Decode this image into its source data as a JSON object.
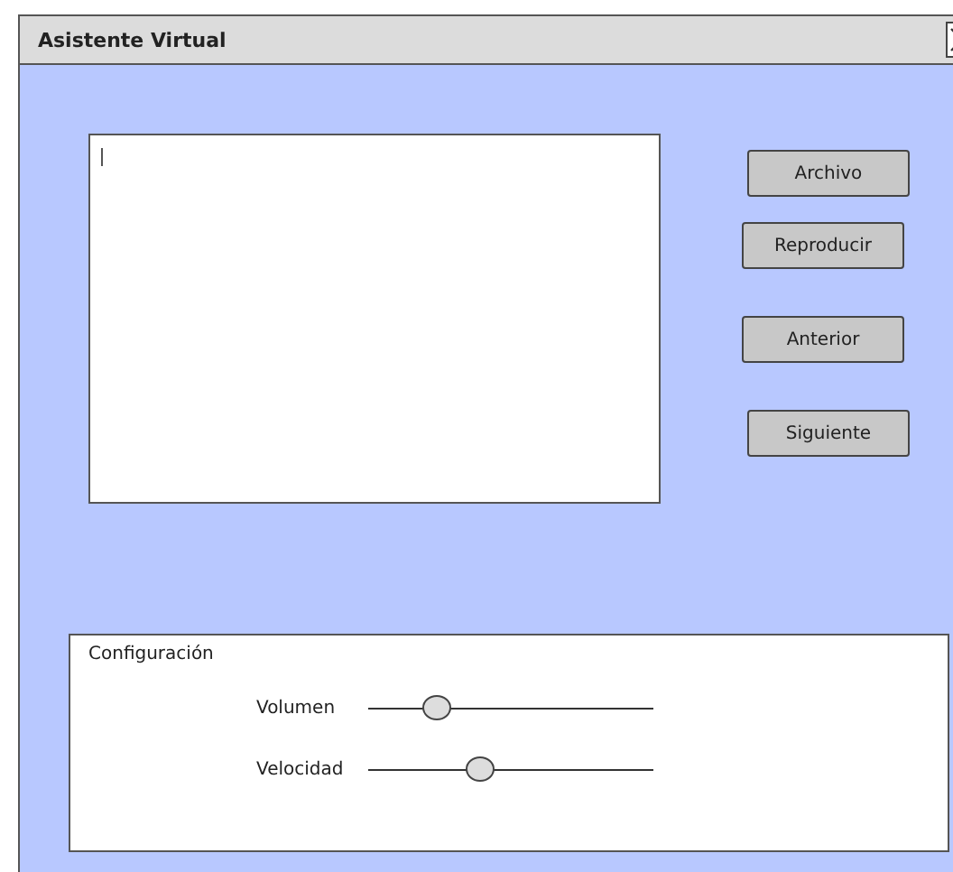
{
  "window": {
    "title": "Asistente Virtual"
  },
  "buttons": [
    "Archivo",
    "Reproducir",
    "Anterior",
    "Siguiente"
  ],
  "settings": {
    "title": "Configuración",
    "sliders": [
      {
        "label": "Volumen",
        "level": 0.24
      },
      {
        "label": "Velocidad",
        "level": 0.39
      }
    ]
  }
}
